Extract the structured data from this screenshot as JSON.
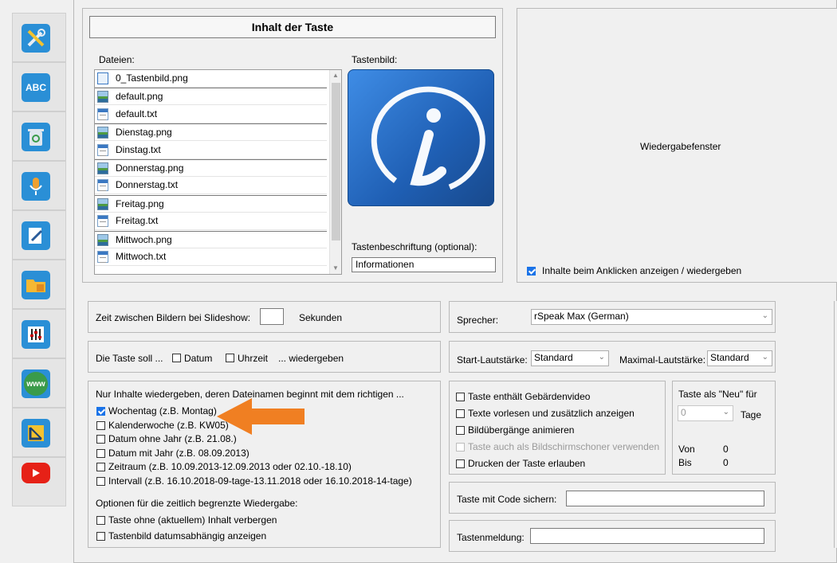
{
  "toolbar": {
    "items": [
      {
        "icon": "tools-icon"
      },
      {
        "icon": "spelling-icon",
        "text": "ABC"
      },
      {
        "icon": "recycle-icon"
      },
      {
        "icon": "microphone-icon"
      },
      {
        "icon": "edit-icon"
      },
      {
        "icon": "folder-icon"
      },
      {
        "icon": "mixer-icon"
      },
      {
        "icon": "www-icon",
        "text": "www"
      },
      {
        "icon": "ruler-icon"
      },
      {
        "icon": "youtube-icon"
      }
    ]
  },
  "content": {
    "title": "Inhalt der Taste",
    "files_label": "Dateien:",
    "image_label": "Tastenbild:",
    "files": [
      {
        "name": "0_Tastenbild.png",
        "type": "img0"
      },
      {
        "name": "default.png",
        "type": "png"
      },
      {
        "name": "default.txt",
        "type": "txt"
      },
      {
        "name": "Dienstag.png",
        "type": "png"
      },
      {
        "name": "Dinstag.txt",
        "type": "txt"
      },
      {
        "name": "Donnerstag.png",
        "type": "png"
      },
      {
        "name": "Donnerstag.txt",
        "type": "txt"
      },
      {
        "name": "Freitag.png",
        "type": "png"
      },
      {
        "name": "Freitag.txt",
        "type": "txt"
      },
      {
        "name": "Mittwoch.png",
        "type": "png"
      },
      {
        "name": "Mittwoch.txt",
        "type": "txt"
      }
    ],
    "caption_label": "Tastenbeschriftung (optional):",
    "caption_value": "Informationen"
  },
  "playback": {
    "label": "Wiedergabefenster",
    "show_on_click": "Inhalte beim Anklicken anzeigen / wiedergeben",
    "show_on_click_checked": true
  },
  "slideshow": {
    "label": "Zeit zwischen Bildern bei Slideshow:",
    "value": "",
    "unit": "Sekunden"
  },
  "play_options": {
    "prefix": "Die Taste soll ...",
    "date": "Datum",
    "time": "Uhrzeit",
    "suffix": "... wiedergeben"
  },
  "filter": {
    "heading": "Nur Inhalte wiedergeben, deren Dateinamen beginnt mit dem richtigen ...",
    "options": [
      {
        "label": "Wochentag (z.B. Montag)",
        "checked": true
      },
      {
        "label": "Kalenderwoche (z.B. KW05)",
        "checked": false
      },
      {
        "label": "Datum ohne Jahr (z.B. 21.08.)",
        "checked": false
      },
      {
        "label": "Datum mit Jahr (z.B. 08.09.2013)",
        "checked": false
      },
      {
        "label": "Zeitraum (z.B. 10.09.2013-12.09.2013 oder 02.10.-18.10)",
        "checked": false
      },
      {
        "label": "Intervall (z.B. 16.10.2018-09-tage-13.11.2018 oder 16.10.2018-14-tage)",
        "checked": false
      }
    ],
    "time_options_label": "Optionen für die zeitlich begrenzte Wiedergabe:",
    "time_options": [
      {
        "label": "Taste ohne (aktuellem) Inhalt verbergen",
        "checked": false
      },
      {
        "label": "Tastenbild datumsabhängig anzeigen",
        "checked": false
      }
    ]
  },
  "speaker": {
    "label": "Sprecher:",
    "value": "rSpeak Max (German)"
  },
  "volume": {
    "start_label": "Start-Lautstärke:",
    "start_value": "Standard",
    "max_label": "Maximal-Lautstärke:",
    "max_value": "Standard"
  },
  "features": {
    "options": [
      {
        "label": "Taste enthält Gebärdenvideo",
        "checked": false,
        "disabled": false
      },
      {
        "label": "Texte vorlesen und zusätzlich anzeigen",
        "checked": false,
        "disabled": false
      },
      {
        "label": "Bildübergänge animieren",
        "checked": false,
        "disabled": false
      },
      {
        "label": "Taste auch als Bildschirmschoner verwenden",
        "checked": false,
        "disabled": true
      },
      {
        "label": "Drucken der Taste erlauben",
        "checked": false,
        "disabled": false
      }
    ]
  },
  "new_badge": {
    "title": "Taste als \"Neu\" für",
    "value": "0",
    "unit": "Tage",
    "from_label": "Von",
    "from_value": "0",
    "to_label": "Bis",
    "to_value": "0"
  },
  "code": {
    "label": "Taste mit Code sichern:",
    "value": ""
  },
  "message": {
    "label": "Tastenmeldung:",
    "value": ""
  },
  "colors": {
    "accent": "#1a73e8",
    "arrow": "#f07f22",
    "tile": "#1f5fb4"
  }
}
